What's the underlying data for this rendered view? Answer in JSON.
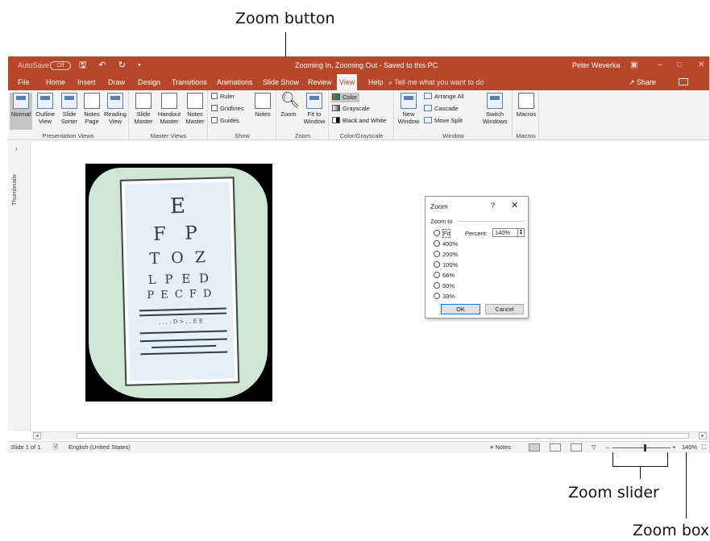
{
  "callouts": {
    "zoom_button": "Zoom button",
    "zoom_slider": "Zoom slider",
    "zoom_box": "Zoom box"
  },
  "titlebar": {
    "autosave": "AutoSave",
    "autosave_state": "Off",
    "title": "Zooming In, Zooming Out - Saved to this PC",
    "user": "Peter Weverka"
  },
  "tabs": [
    "File",
    "Home",
    "Insert",
    "Draw",
    "Design",
    "Transitions",
    "Animations",
    "Slide Show",
    "Review",
    "View",
    "Help"
  ],
  "active_tab": "View",
  "tell_me": "Tell me what you want to do",
  "share": "Share",
  "ribbon": {
    "presentation_views": {
      "label": "Presentation Views",
      "normal": "Normal",
      "outline": "Outline View",
      "sorter": "Slide Sorter",
      "notes_page": "Notes Page",
      "reading": "Reading View"
    },
    "master_views": {
      "label": "Master Views",
      "slide": "Slide Master",
      "handout": "Handout Master",
      "notes": "Notes Master"
    },
    "show": {
      "label": "Show",
      "ruler": "Ruler",
      "gridlines": "Gridlines",
      "guides": "Guides",
      "notes": "Notes"
    },
    "zoom": {
      "label": "Zoom",
      "zoom": "Zoom",
      "fit": "Fit to Window"
    },
    "color": {
      "label": "Color/Grayscale",
      "color": "Color",
      "grayscale": "Grayscale",
      "bw": "Black and White"
    },
    "window": {
      "label": "Window",
      "new": "New Window",
      "arrange": "Arrange All",
      "cascade": "Cascade",
      "move_split": "Move Split",
      "switch": "Switch Windows"
    },
    "macros": {
      "label": "Macros",
      "macros": "Macros"
    }
  },
  "thumbnails": "Thumbnails",
  "eye_chart": {
    "rows": [
      "E",
      "F P",
      "T O Z",
      "L P E D",
      "P E C F D",
      ". . . : D > . . E E"
    ]
  },
  "dialog": {
    "title": "Zoom",
    "help": "?",
    "group": "Zoom to",
    "fit": "Fit",
    "percent_label": "Percent:",
    "percent_value": "140%",
    "options": [
      "400%",
      "200%",
      "100%",
      "66%",
      "50%",
      "33%"
    ],
    "ok": "OK",
    "cancel": "Cancel"
  },
  "status": {
    "slide": "Slide 1 of 1",
    "language": "English (United States)",
    "notes": "Notes",
    "zoom_pct": "140%",
    "zoom_level": 0.54
  }
}
